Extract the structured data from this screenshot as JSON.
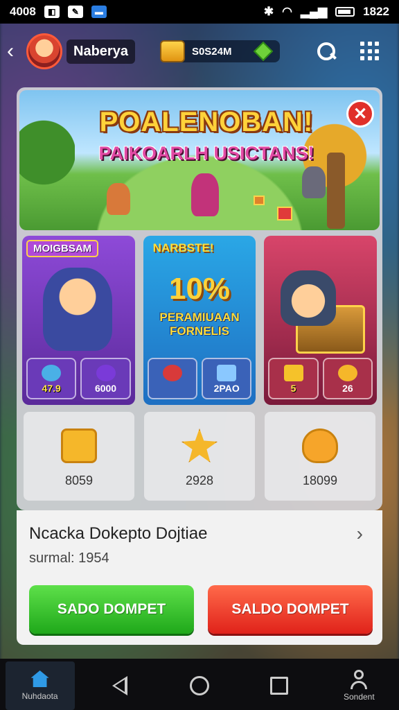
{
  "status_bar": {
    "left_text": "4008",
    "time": "1822"
  },
  "header": {
    "username": "Naberya",
    "currency_amount": "S0S24M"
  },
  "banner": {
    "title": "POALENOBAN!",
    "subtitle": "PAIKOARLH USICTANS!"
  },
  "cards": [
    {
      "label": "MOIGBSAM",
      "chips": [
        "47.9",
        "6000"
      ]
    },
    {
      "label": "NARBSTE!",
      "headline": "10%",
      "text_line1": "PERAMIUAAN",
      "text_line2": "FORNELIS",
      "chips": [
        "",
        "2PAO"
      ]
    },
    {
      "label": "",
      "chips": [
        "5",
        "26"
      ]
    }
  ],
  "tiles": [
    {
      "value": "8059",
      "icon": "square-face-icon"
    },
    {
      "value": "2928",
      "icon": "star-face-icon"
    },
    {
      "value": "18099",
      "icon": "blob-face-icon"
    }
  ],
  "sheet": {
    "title": "Ncacka Dokepto Dojtiae",
    "subtitle": "surmal: 1954",
    "primary_button": "SADO DOMPET",
    "secondary_button": "SALDO DOMPET"
  },
  "system_nav": {
    "home_label": "Nuhdaota",
    "profile_label": "Sondent"
  },
  "colors": {
    "primary_green": "#1fa81a",
    "secondary_red": "#e0221a",
    "accent_gold": "#ffd23a"
  }
}
